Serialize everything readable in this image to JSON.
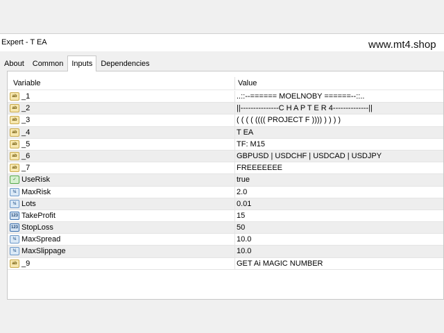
{
  "window": {
    "title": "Expert - T EA",
    "watermark": "www.mt4.shop"
  },
  "tabs": [
    {
      "label": "About",
      "active": false
    },
    {
      "label": "Common",
      "active": false
    },
    {
      "label": "Inputs",
      "active": true
    },
    {
      "label": "Dependencies",
      "active": false
    }
  ],
  "grid": {
    "headers": {
      "variable": "Variable",
      "value": "Value"
    },
    "rows": [
      {
        "icon": "string-icon",
        "name": "_1",
        "value": "..::--====== MOELNOBY ======--::.."
      },
      {
        "icon": "string-icon",
        "name": "_2",
        "value": "||---------------C H A P T E R  4--------------||"
      },
      {
        "icon": "string-icon",
        "name": "_3",
        "value": "( ( ( ( (((( PROJECT F )))) ) ) ) )"
      },
      {
        "icon": "string-icon",
        "name": "_4",
        "value": "T EA"
      },
      {
        "icon": "string-icon",
        "name": "_5",
        "value": "TF: M15"
      },
      {
        "icon": "string-icon",
        "name": "_6",
        "value": "GBPUSD | USDCHF | USDCAD | USDJPY"
      },
      {
        "icon": "string-icon",
        "name": "_7",
        "value": "FREEEEEEE"
      },
      {
        "icon": "bool-icon",
        "name": "UseRisk",
        "value": "true"
      },
      {
        "icon": "double-icon",
        "name": "MaxRisk",
        "value": "2.0"
      },
      {
        "icon": "double-icon",
        "name": "Lots",
        "value": "0.01"
      },
      {
        "icon": "integer-icon",
        "name": "TakeProfit",
        "value": "15"
      },
      {
        "icon": "integer-icon",
        "name": "StopLoss",
        "value": "50"
      },
      {
        "icon": "double-icon",
        "name": "MaxSpread",
        "value": "10.0"
      },
      {
        "icon": "double-icon",
        "name": "MaxSlippage",
        "value": "10.0"
      },
      {
        "icon": "string-icon",
        "name": "_9",
        "value": "GET Ai MAGIC NUMBER"
      }
    ]
  }
}
